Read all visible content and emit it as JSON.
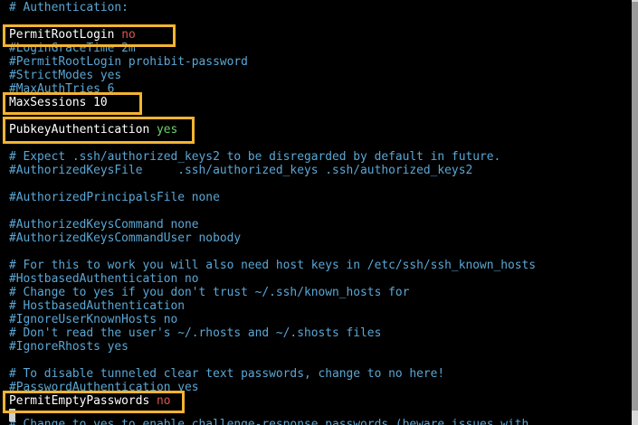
{
  "terminal": {
    "lines": [
      {
        "text": "# Authentication:"
      },
      {
        "text": ""
      },
      {
        "key": "PermitRootLogin",
        "value": "no"
      },
      {
        "text": "#LoginGraceTime 2m"
      },
      {
        "text": "#PermitRootLogin prohibit-password"
      },
      {
        "text": "#StrictModes yes"
      },
      {
        "text": "#MaxAuthTries 6"
      },
      {
        "text": "MaxSessions 10"
      },
      {
        "text": ""
      },
      {
        "key": "PubkeyAuthentication",
        "value": "yes"
      },
      {
        "text": ""
      },
      {
        "text": "# Expect .ssh/authorized_keys2 to be disregarded by default in future."
      },
      {
        "text": "#AuthorizedKeysFile     .ssh/authorized_keys .ssh/authorized_keys2"
      },
      {
        "text": ""
      },
      {
        "text": "#AuthorizedPrincipalsFile none"
      },
      {
        "text": ""
      },
      {
        "text": "#AuthorizedKeysCommand none"
      },
      {
        "text": "#AuthorizedKeysCommandUser nobody"
      },
      {
        "text": ""
      },
      {
        "text": "# For this to work you will also need host keys in /etc/ssh/ssh_known_hosts"
      },
      {
        "text": "#HostbasedAuthentication no"
      },
      {
        "text": "# Change to yes if you don't trust ~/.ssh/known_hosts for"
      },
      {
        "text": "# HostbasedAuthentication"
      },
      {
        "text": "#IgnoreUserKnownHosts no"
      },
      {
        "text": "# Don't read the user's ~/.rhosts and ~/.shosts files"
      },
      {
        "text": "#IgnoreRhosts yes"
      },
      {
        "text": ""
      },
      {
        "text": "# To disable tunneled clear text passwords, change to no here!"
      },
      {
        "text": "#PasswordAuthentication yes"
      },
      {
        "key": "PermitEmptyPasswords",
        "value": "no"
      },
      {
        "text": "# Change to yes to enable challenge-response passwords (beware issues with"
      }
    ]
  },
  "colors": {
    "comment": "#5aa7d6",
    "default": "#ffffff",
    "value_no": "#e0544f",
    "value_yes": "#6bd46b",
    "highlight_box": "#f3b431",
    "background": "#000000"
  }
}
